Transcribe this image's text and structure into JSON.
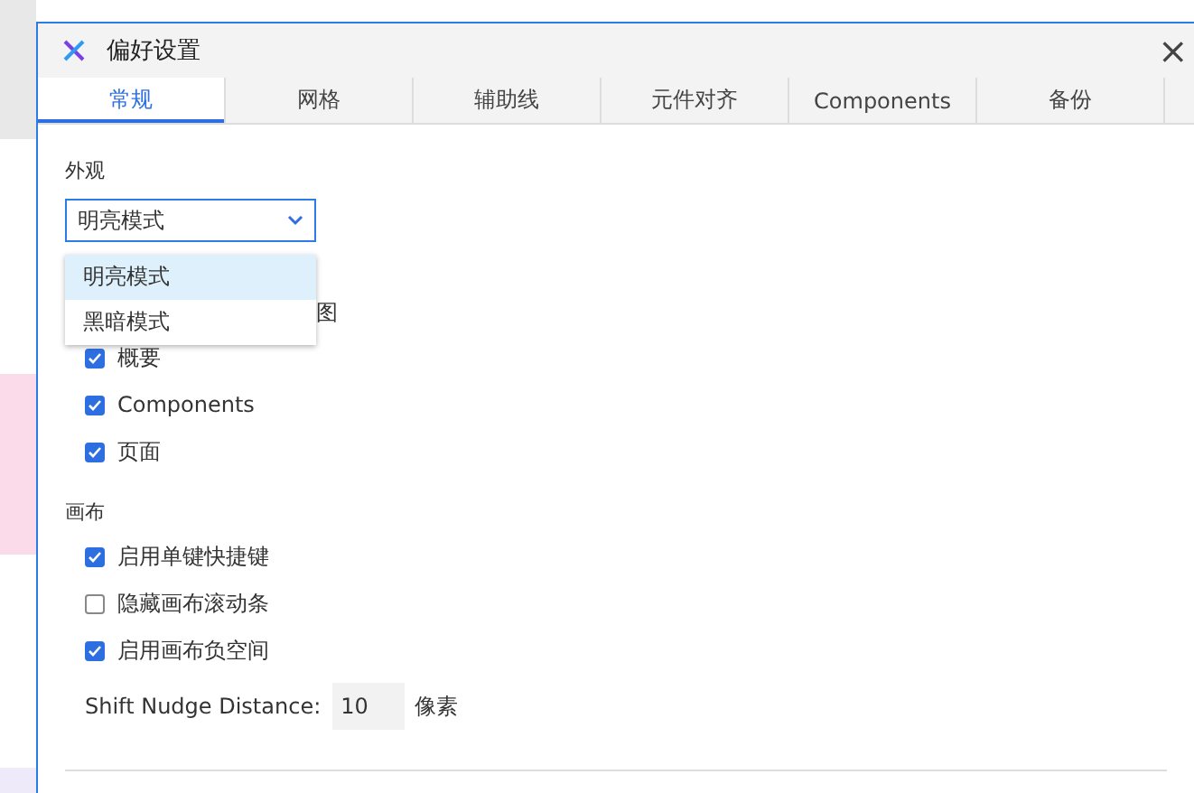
{
  "window": {
    "title": "偏好设置",
    "close": "×"
  },
  "tabs": [
    {
      "label": "常规",
      "selected": true
    },
    {
      "label": "网格",
      "selected": false
    },
    {
      "label": "辅助线",
      "selected": false
    },
    {
      "label": "元件对齐",
      "selected": false
    },
    {
      "label": "Components",
      "selected": false
    },
    {
      "label": "备份",
      "selected": false
    }
  ],
  "appearance": {
    "label": "外观",
    "select": {
      "value": "明亮模式",
      "expanded": true,
      "options": [
        {
          "label": "明亮模式",
          "selected": true
        },
        {
          "label": "黑暗模式",
          "selected": false
        }
      ]
    }
  },
  "panels": {
    "partial_label": "图",
    "items": [
      {
        "label": "概要",
        "checked": true
      },
      {
        "label": "Components",
        "checked": true
      },
      {
        "label": "页面",
        "checked": true
      }
    ]
  },
  "canvas": {
    "label": "画布",
    "items": [
      {
        "label": "启用单键快捷键",
        "checked": true
      },
      {
        "label": "隐藏画布滚动条",
        "checked": false
      },
      {
        "label": "启用画布负空间",
        "checked": true
      }
    ],
    "nudge": {
      "label": "Shift Nudge Distance:",
      "value": "10",
      "unit": "像素"
    }
  }
}
